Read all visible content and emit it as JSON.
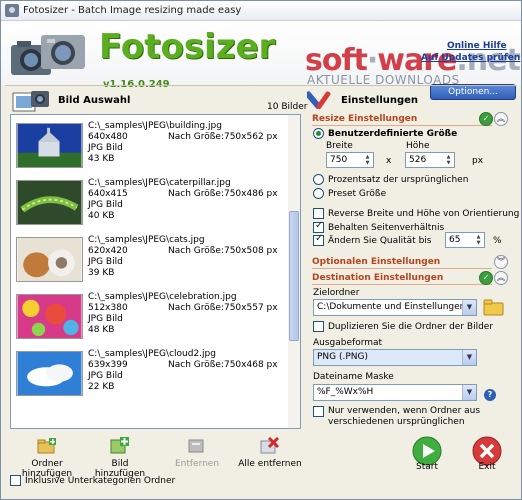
{
  "window": {
    "title": "Fotosizer - Batch Image resizing made easy"
  },
  "header": {
    "app_name": "Fotosizer",
    "version": "v1.16.0.249",
    "online_help": "Online Hilfe",
    "update_check": "Auf Updates prüfen",
    "options_button": "Optionen..."
  },
  "watermark": {
    "main_a": "soft",
    "main_b": "ware",
    "main_c": ".net",
    "sub": "AKTUELLE DOWNLOADS"
  },
  "left": {
    "title": "Bild Auswahl",
    "count": "10 Bilder",
    "items": [
      {
        "path": "C:\\_samples\\JPEG\\building.jpg",
        "dims": "640x480",
        "target": "Nach Größe:750x562 px",
        "type": "JPG Bild",
        "size": "43 KB",
        "thumb": "building"
      },
      {
        "path": "C:\\_samples\\JPEG\\caterpillar.jpg",
        "dims": "640x415",
        "target": "Nach Größe:750x486 px",
        "type": "JPG Bild",
        "size": "40 KB",
        "thumb": "caterpillar"
      },
      {
        "path": "C:\\_samples\\JPEG\\cats.jpg",
        "dims": "620x420",
        "target": "Nach Größe:750x508 px",
        "type": "JPG Bild",
        "size": "39 KB",
        "thumb": "cats"
      },
      {
        "path": "C:\\_samples\\JPEG\\celebration.jpg",
        "dims": "512x380",
        "target": "Nach Größe:750x557 px",
        "type": "JPG Bild",
        "size": "48 KB",
        "thumb": "celebration"
      },
      {
        "path": "C:\\_samples\\JPEG\\cloud2.jpg",
        "dims": "639x399",
        "target": "Nach Größe:750x468 px",
        "type": "JPG Bild",
        "size": "22 KB",
        "thumb": "cloud"
      }
    ]
  },
  "toolbar": {
    "add_folder": "Ordner hinzufügen",
    "add_image": "Bild hinzufügen",
    "remove": "Entfernen",
    "remove_all": "Alle entfernen",
    "include_sub": "Inklusive Unterkategorien Ordner"
  },
  "settings": {
    "title": "Einstellungen",
    "resize_section": "Resize Einstellungen",
    "custom_size": "Benutzerdefinierte Größe",
    "width_label": "Breite",
    "height_label": "Höhe",
    "width_value": "750",
    "height_value": "526",
    "x_sep": "x",
    "px_unit": "px",
    "percent_option": "Prozentsatz der ursprünglichen",
    "preset_option": "Preset Größe",
    "reverse_orientation": "Reverse Breite und Höhe von Orientierung",
    "keep_ratio": "Behalten Seitenverhältnis",
    "change_quality": "Ändern Sie Qualität bis",
    "quality_value": "65",
    "percent_unit": "%",
    "optional_section": "Optionalen Einstellungen",
    "destination_section": "Destination Einstellungen",
    "target_folder_label": "Zielordner",
    "target_folder_value": "C:\\Dokumente und Einstellungen\\F",
    "duplicate_folders": "Duplizieren Sie die Ordner der Bilder",
    "output_format_label": "Ausgabeformat",
    "output_format_value": "PNG (.PNG)",
    "filename_mask_label": "Dateiname Maske",
    "filename_mask_value": "%F_%Wx%H",
    "only_diff_folder_1": "Nur verwenden, wenn Ordner aus",
    "only_diff_folder_2": "verschiedenen ursprünglichen"
  },
  "actions": {
    "start": "Start",
    "exit": "Exit"
  },
  "colors": {
    "accent_green": "#5aae20",
    "section_title": "#b8441c",
    "link_blue": "#1c3e9a"
  }
}
